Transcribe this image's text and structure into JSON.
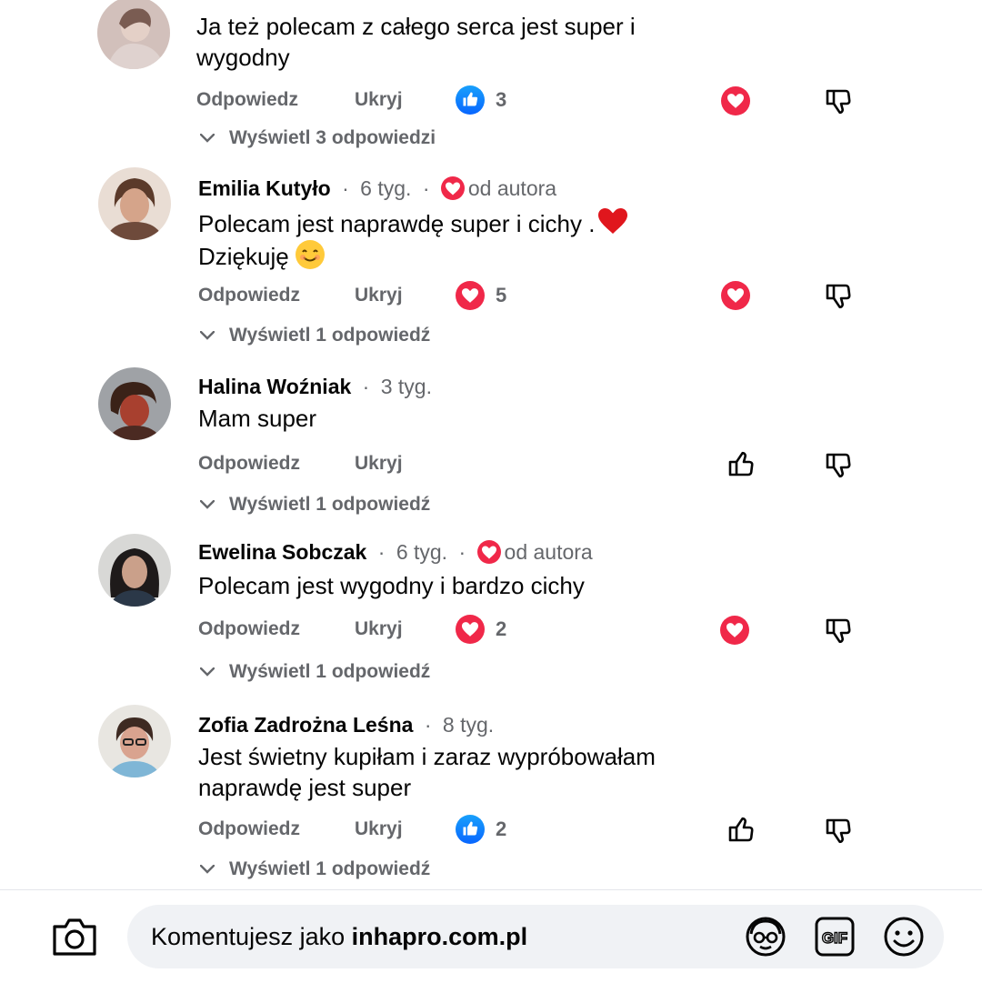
{
  "comments": [
    {
      "author": "",
      "time": "",
      "text_line1": "Ja też polecam z całego serca jest super i",
      "text_line2": "wygodny",
      "reply": "Odpowiedz",
      "hide": "Ukryj",
      "reaction_type": "like",
      "reaction_count": "3",
      "view_replies": "Wyświetl 3 odpowiedzi"
    },
    {
      "author": "Emilia Kutyło",
      "time": "6 tyg.",
      "author_badge": "od autora",
      "text_line1": "Polecam jest naprawdę super i cichy .",
      "text_line2": "Dziękuję",
      "reply": "Odpowiedz",
      "hide": "Ukryj",
      "reaction_type": "love",
      "reaction_count": "5",
      "view_replies": "Wyświetl 1 odpowiedź"
    },
    {
      "author": "Halina Woźniak",
      "time": "3 tyg.",
      "text_line1": "Mam super",
      "reply": "Odpowiedz",
      "hide": "Ukryj",
      "view_replies": "Wyświetl 1 odpowiedź"
    },
    {
      "author": "Ewelina Sobczak",
      "time": "6 tyg.",
      "author_badge": "od autora",
      "text_line1": "Polecam jest wygodny i bardzo cichy",
      "reply": "Odpowiedz",
      "hide": "Ukryj",
      "reaction_type": "love",
      "reaction_count": "2",
      "view_replies": "Wyświetl 1 odpowiedź"
    },
    {
      "author": "Zofia Zadrożna Leśna",
      "time": "8 tyg.",
      "text_line1": "Jest świetny kupiłam i zaraz wypróbowałam",
      "text_line2": "naprawdę jest super",
      "reply": "Odpowiedz",
      "hide": "Ukryj",
      "reaction_type": "like",
      "reaction_count": "2",
      "view_replies": "Wyświetl 1 odpowiedź"
    }
  ],
  "composer": {
    "prefix": "Komentujesz jako",
    "page_name": "inhapro.com.pl"
  },
  "icons": {
    "camera": "camera-icon",
    "avatar_sticker": "avatar-sticker-icon",
    "gif": "gif-icon",
    "emoji": "emoji-icon",
    "like_outline": "thumbs-up-outline-icon",
    "dislike": "thumbs-down-outline-icon"
  },
  "colors": {
    "like_blue": "#0866ff",
    "love_red": "#f02849",
    "secondary_text": "#65676b"
  }
}
